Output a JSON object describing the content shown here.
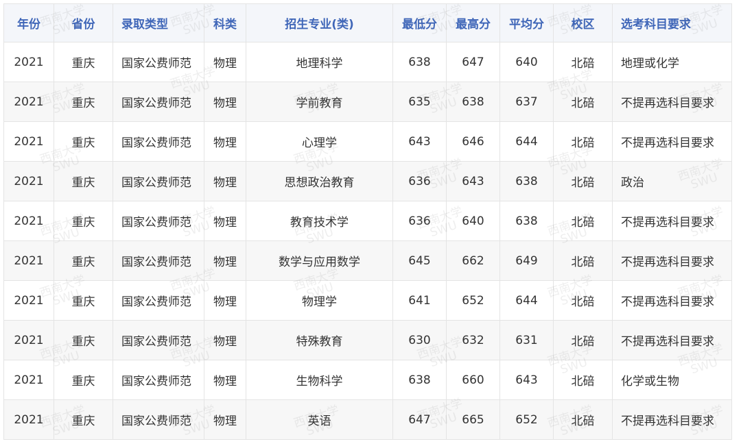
{
  "table": {
    "headers": [
      "年份",
      "省份",
      "录取类型",
      "科类",
      "招生专业(类)",
      "最低分",
      "最高分",
      "平均分",
      "校区",
      "选考科目要求"
    ],
    "rows": [
      [
        "2021",
        "重庆",
        "国家公费师范",
        "物理",
        "地理科学",
        "638",
        "647",
        "640",
        "北碚",
        "地理或化学"
      ],
      [
        "2021",
        "重庆",
        "国家公费师范",
        "物理",
        "学前教育",
        "635",
        "638",
        "637",
        "北碚",
        "不提再选科目要求"
      ],
      [
        "2021",
        "重庆",
        "国家公费师范",
        "物理",
        "心理学",
        "643",
        "646",
        "644",
        "北碚",
        "不提再选科目要求"
      ],
      [
        "2021",
        "重庆",
        "国家公费师范",
        "物理",
        "思想政治教育",
        "636",
        "643",
        "638",
        "北碚",
        "政治"
      ],
      [
        "2021",
        "重庆",
        "国家公费师范",
        "物理",
        "教育技术学",
        "636",
        "640",
        "638",
        "北碚",
        "不提再选科目要求"
      ],
      [
        "2021",
        "重庆",
        "国家公费师范",
        "物理",
        "数学与应用数学",
        "645",
        "662",
        "649",
        "北碚",
        "不提再选科目要求"
      ],
      [
        "2021",
        "重庆",
        "国家公费师范",
        "物理",
        "物理学",
        "641",
        "652",
        "644",
        "北碚",
        "不提再选科目要求"
      ],
      [
        "2021",
        "重庆",
        "国家公费师范",
        "物理",
        "特殊教育",
        "630",
        "632",
        "631",
        "北碚",
        "不提再选科目要求"
      ],
      [
        "2021",
        "重庆",
        "国家公费师范",
        "物理",
        "生物科学",
        "638",
        "660",
        "643",
        "北碚",
        "化学或生物"
      ],
      [
        "2021",
        "重庆",
        "国家公费师范",
        "物理",
        "英语",
        "647",
        "665",
        "652",
        "北碚",
        "不提再选科目要求"
      ]
    ]
  },
  "watermark": {
    "cn": "西南大学",
    "en": "SWU"
  },
  "colors": {
    "header_text": "#3f66b8",
    "header_bg": "#f4f6fa",
    "row_alt_bg": "#f7f7f7",
    "border": "#e4e4e4",
    "cell_text": "#333333"
  }
}
